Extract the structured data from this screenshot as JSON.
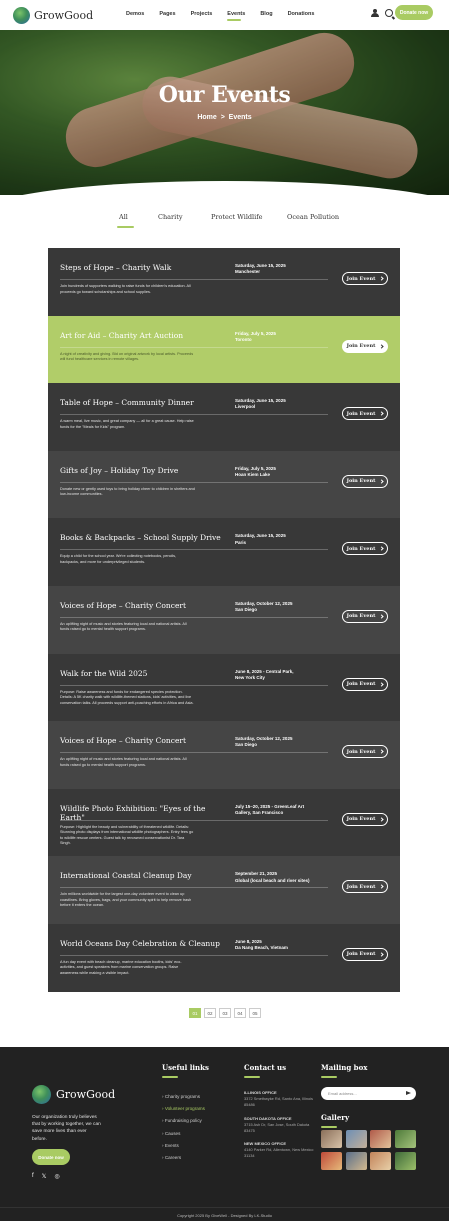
{
  "header": {
    "logo_text": "GrowGood",
    "nav": [
      "Demos",
      "Pages",
      "Projects",
      "Events",
      "Blog",
      "Donations"
    ],
    "donate_label": "Donate now"
  },
  "hero": {
    "title": "Our Events",
    "breadcrumb_home": "Home",
    "breadcrumb_sep": ">",
    "breadcrumb_current": "Events"
  },
  "filters": [
    "All",
    "Charity",
    "Protect Wildlife",
    "Ocean Pollution"
  ],
  "events": [
    {
      "title": "Steps of Hope – Charity Walk",
      "date": "Saturday, June 15, 2025",
      "location": "Manchester",
      "desc": "Join hundreds of supporters walking to raise funds for children's education. All proceeds go toward scholarships and school supplies."
    },
    {
      "title": "Art for Aid – Charity Art Auction",
      "date": "Friday, July 5, 2025",
      "location": "Toronto",
      "desc": "A night of creativity and giving. Bid on original artwork by local artists. Proceeds will fund healthcare services in remote villages."
    },
    {
      "title": "Table of Hope – Community Dinner",
      "date": "Saturday, June 15, 2025",
      "location": "Liverpool",
      "desc": "A warm meal, live music, and great company — all for a great cause. Help raise funds for the \"Meals for Kids\" program."
    },
    {
      "title": "Gifts of Joy – Holiday Toy Drive",
      "date": "Friday, July 5, 2025",
      "location": "Hoan Kiem Lake",
      "desc": "Donate new or gently used toys to bring holiday cheer to children in shelters and low-income communities."
    },
    {
      "title": "Books & Backpacks – School Supply Drive",
      "date": "Saturday, June 15, 2025",
      "location": "Paris",
      "desc": "Equip a child for the school year. We're collecting notebooks, pencils, backpacks, and more for underprivileged students."
    },
    {
      "title": "Voices of Hope – Charity Concert",
      "date": "Saturday, October 12, 2025",
      "location": "San Diego",
      "desc": "An uplifting night of music and stories featuring local and national artists. All funds raised go to mental health support programs."
    },
    {
      "title": "Walk for the Wild 2025",
      "date": "June 8, 2025 - Central Park,",
      "location": "New York City",
      "desc": "Purpose: Raise awareness and funds for endangered species protection. Details: A 5K charity walk with wildlife-themed stations, kids' activities, and live conservation talks. All proceeds support anti-poaching efforts in Africa and Asia."
    },
    {
      "title": "Voices of Hope – Charity Concert",
      "date": "Saturday, October 12, 2025",
      "location": "San Diego",
      "desc": "An uplifting night of music and stories featuring local and national artists. All funds raised go to mental health support programs."
    },
    {
      "title": "Wildlife Photo Exhibition: \"Eyes of the Earth\"",
      "date": "July 15–20, 2025 - GreenLeaf Art",
      "location": "Gallery, San Francisco",
      "desc": "Purpose: Highlight the beauty and vulnerability of threatened wildlife. Details: Stunning photo displays from international wildlife photographers. Entry fees go to wildlife rescue centers. Guest talk by renowned conservationist Dr. Tara Singh."
    },
    {
      "title": "International Coastal Cleanup Day",
      "date": "September 21, 2025",
      "location": "Global (local beach and river sites)",
      "desc": "Join millions worldwide for the largest one-day volunteer event to clean up coastlines. Bring gloves, bags, and your community spirit to help remove trash before it enters the ocean."
    },
    {
      "title": "World Oceans Day Celebration & Cleanup",
      "date": "June 8, 2025",
      "location": "Da Nang Beach, Vietnam",
      "desc": "A fun day event with beach cleanup, marine education booths, kids' eco-activities, and guest speakers from marine conservation groups. Raise awareness while making a visible impact."
    }
  ],
  "join_label": "Join Event",
  "pagination": [
    "01",
    "02",
    "03",
    "04",
    "05"
  ],
  "footer": {
    "logo_text": "GrowGood",
    "about": "Our organization truly believes that by working together, we can save more lives than ever before.",
    "donate_label": "Donate now",
    "social": [
      "f",
      "𝕏",
      "◎"
    ],
    "useful_links_title": "Useful links",
    "useful_links": [
      "Charity programs",
      "Volunteer programs",
      "Fundraising policy",
      "Causes",
      "Events",
      "Careers"
    ],
    "contact_title": "Contact us",
    "offices": [
      {
        "name": "ILLINOIS OFFICE",
        "address": "3372 Smethwyke Rd, Santo Ana, Illinois 85486"
      },
      {
        "name": "SOUTH DAKOTA OFFICE",
        "address": "3715 Ash Dr, San Jose, South Dakota 83475"
      },
      {
        "name": "NEW MEXICO OFFICE",
        "address": "4140 Parker Rd, Allentown, New Mexico 31134"
      }
    ],
    "mailing_title": "Mailing box",
    "email_placeholder": "Email address...",
    "gallery_title": "Gallery",
    "copyright": "Copyright 2025 By GiveWell - Designed By LK-Studio"
  },
  "colors": {
    "accent": "#a9cb63",
    "event_dark": "#383838",
    "event_alt": "#454545",
    "event_highlight": "#b1cd69",
    "footer": "#222222"
  }
}
